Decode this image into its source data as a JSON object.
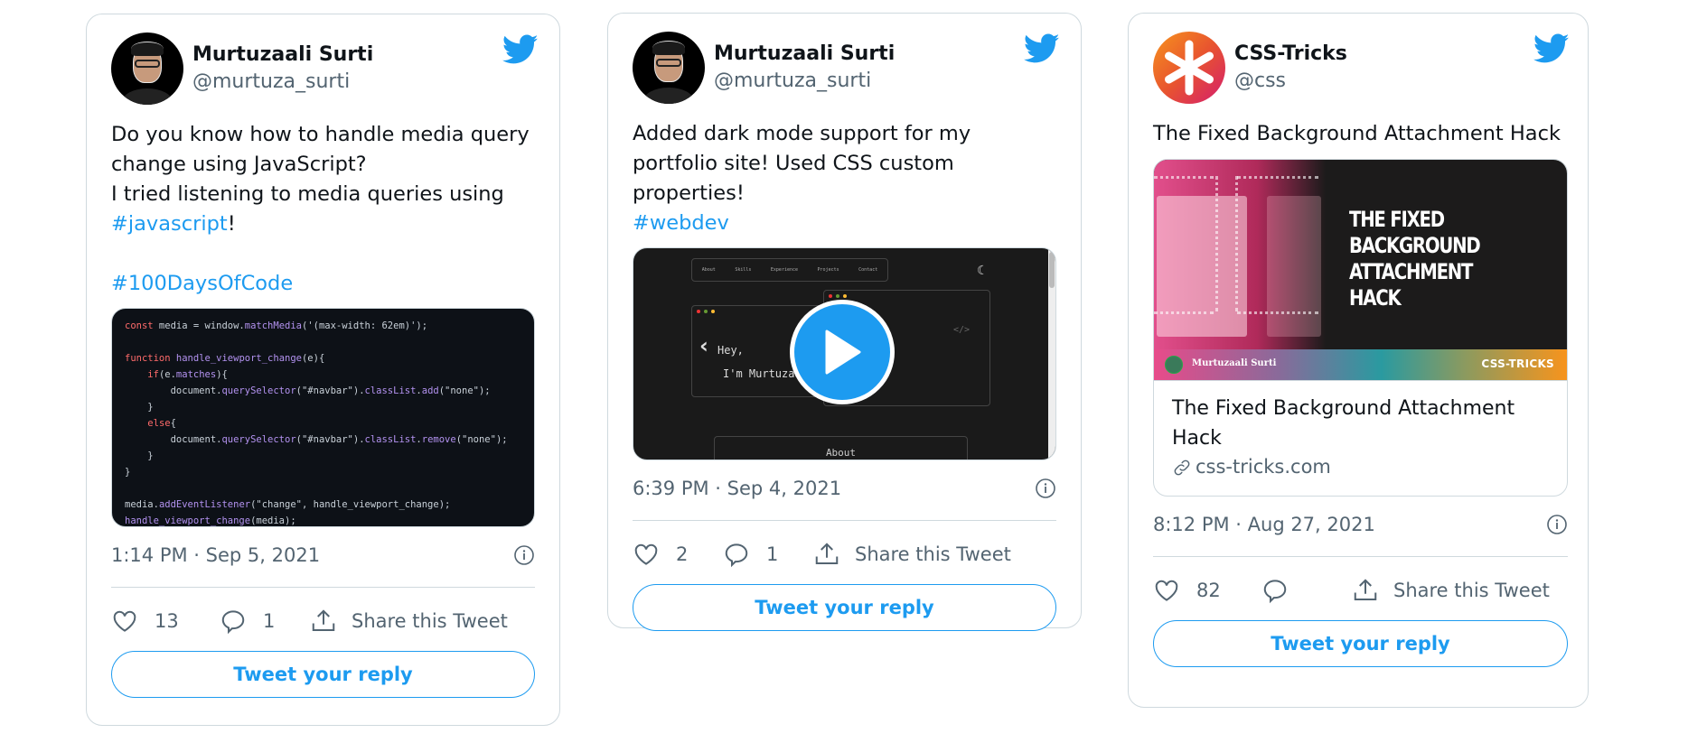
{
  "colors": {
    "accent": "#1d9bf0",
    "text_primary": "#0f1419",
    "text_secondary": "#536471",
    "border": "#cfd9de"
  },
  "tweets": [
    {
      "author": {
        "name": "Murtuzaali Surti",
        "handle": "@murtuza_surti",
        "avatar": "person-avatar"
      },
      "text_lines": [
        "Do you know how to handle media query change using JavaScript?",
        "I tried listening to media queries using"
      ],
      "hashtag_inline": "#javascript",
      "hashtag_suffix": "!",
      "hashtag_block": "#100DaysOfCode",
      "media": {
        "type": "code-image",
        "code_lines": [
          "const media = window.matchMedia('(max-width: 62em)');",
          "",
          "function handle_viewport_change(e){",
          "    if(e.matches){",
          "        document.querySelector(\"#navbar\").classList.add(\"none\");",
          "    }",
          "    else{",
          "        document.querySelector(\"#navbar\").classList.remove(\"none\");",
          "    }",
          "}",
          "",
          "media.addEventListener(\"change\", handle_viewport_change);",
          "handle_viewport_change(media);"
        ]
      },
      "timestamp": "1:14 PM · Sep 5, 2021",
      "likes": "13",
      "replies": "1",
      "share_label": "Share this Tweet",
      "reply_button": "Tweet your reply"
    },
    {
      "author": {
        "name": "Murtuzaali Surti",
        "handle": "@murtuza_surti",
        "avatar": "person-avatar"
      },
      "text": "Added dark mode support for my portfolio site! Used CSS custom properties!",
      "hashtag_block": "#webdev",
      "media": {
        "type": "video",
        "nav_items": [
          "About",
          "Skills",
          "Experience",
          "Projects",
          "Contact"
        ],
        "greeting_line1": "Hey,",
        "greeting_line2": "I'm Murtuzaali",
        "section_label": "About",
        "code_tag": "</>"
      },
      "timestamp": "6:39 PM · Sep 4, 2021",
      "likes": "2",
      "replies": "1",
      "share_label": "Share this Tweet",
      "reply_button": "Tweet your reply"
    },
    {
      "author": {
        "name": "CSS-Tricks",
        "handle": "@css",
        "avatar": "css-tricks-logo"
      },
      "text": "The Fixed Background Attachment Hack",
      "link_card": {
        "image_headline": [
          "THE FIXED",
          "BACKGROUND",
          "ATTACHMENT HACK"
        ],
        "image_author": "Murtuzaali Surti",
        "image_brand": "CSS-TRICKS",
        "title": "The Fixed Background Attachment Hack",
        "domain": "css-tricks.com"
      },
      "timestamp": "8:12 PM · Aug 27, 2021",
      "likes": "82",
      "replies": "",
      "share_label": "Share this Tweet",
      "reply_button": "Tweet your reply"
    }
  ]
}
